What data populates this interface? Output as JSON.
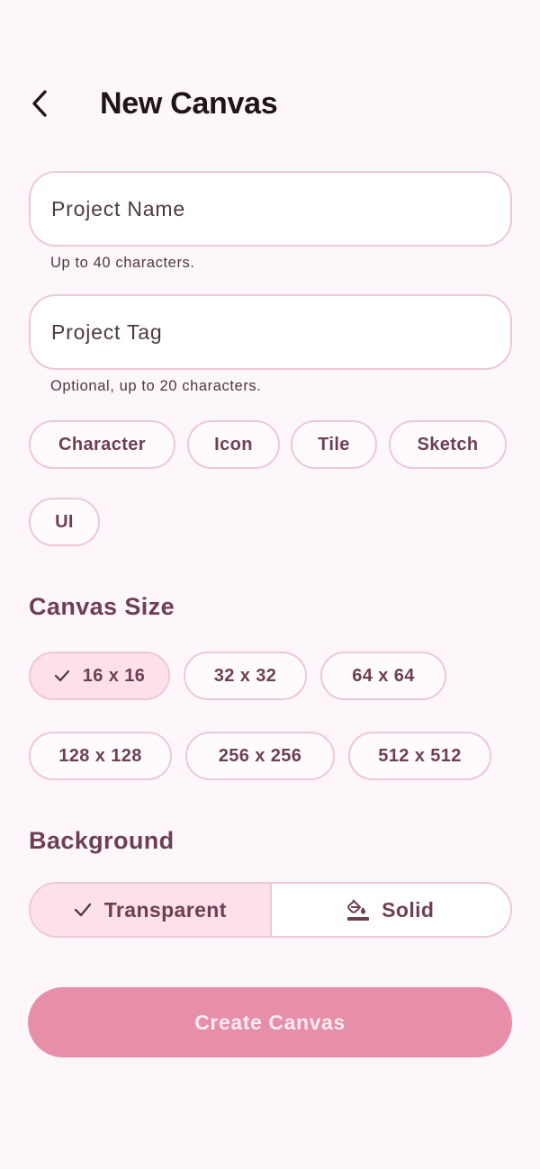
{
  "header": {
    "title": "New Canvas",
    "back_icon": "chevron-left-icon"
  },
  "form": {
    "project_name": {
      "placeholder": "Project Name",
      "value": "",
      "helper": "Up to 40 characters."
    },
    "project_tag": {
      "placeholder": "Project Tag",
      "value": "",
      "helper": "Optional, up to 20 characters."
    }
  },
  "tags": [
    {
      "label": "Character",
      "selected": false
    },
    {
      "label": "Icon",
      "selected": false
    },
    {
      "label": "Tile",
      "selected": false
    },
    {
      "label": "Sketch",
      "selected": false
    },
    {
      "label": "UI",
      "selected": false
    }
  ],
  "canvas_size": {
    "title": "Canvas Size",
    "options": [
      {
        "label": "16 x 16",
        "selected": true
      },
      {
        "label": "32 x 32",
        "selected": false
      },
      {
        "label": "64 x 64",
        "selected": false
      },
      {
        "label": "128 x 128",
        "selected": false
      },
      {
        "label": "256 x 256",
        "selected": false
      },
      {
        "label": "512 x 512",
        "selected": false
      }
    ]
  },
  "background": {
    "title": "Background",
    "options": [
      {
        "label": "Transparent",
        "selected": true,
        "icon": "check-icon"
      },
      {
        "label": "Solid",
        "selected": false,
        "icon": "paint-bucket-icon"
      }
    ]
  },
  "create_button": {
    "label": "Create Canvas"
  },
  "colors": {
    "page_bg": "#fdf6fa",
    "accent": "#6e3f53",
    "outline": "#ecc9d6",
    "selected_fill": "#fde0e8",
    "primary_button": "#e78ea9"
  }
}
